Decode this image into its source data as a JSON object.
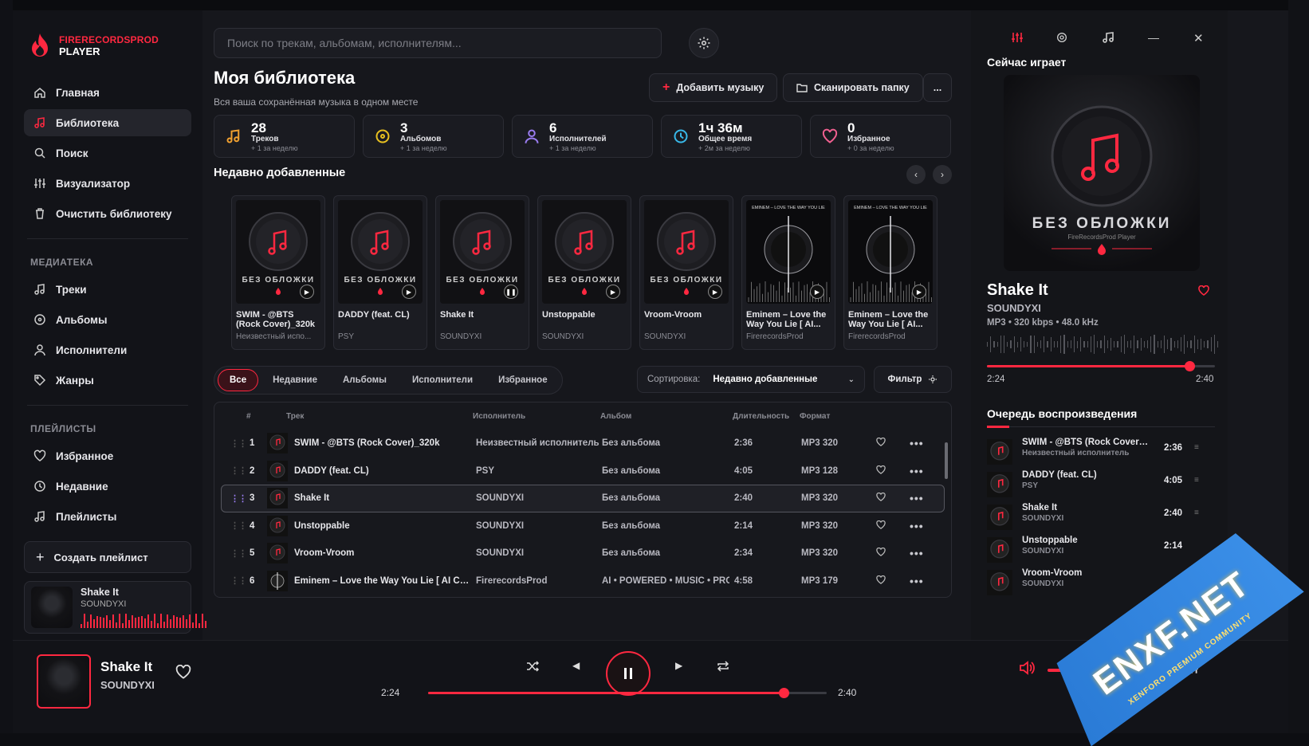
{
  "brand": {
    "name_line1": "FIRERECORDSPROD",
    "name_line2": "PLAYER"
  },
  "sidebar": {
    "nav": [
      {
        "label": "Главная",
        "icon": "home-icon"
      },
      {
        "label": "Библиотека",
        "icon": "music-note-icon",
        "active": true
      },
      {
        "label": "Поиск",
        "icon": "search-icon"
      },
      {
        "label": "Визуализатор",
        "icon": "sliders-icon"
      },
      {
        "label": "Очистить библиотеку",
        "icon": "trash-icon"
      }
    ],
    "media_title": "МЕДИАТЕКА",
    "media": [
      {
        "label": "Треки",
        "icon": "music-note-icon"
      },
      {
        "label": "Альбомы",
        "icon": "disc-icon"
      },
      {
        "label": "Исполнители",
        "icon": "user-icon"
      },
      {
        "label": "Жанры",
        "icon": "tag-icon"
      }
    ],
    "playlists_title": "ПЛЕЙЛИСТЫ",
    "playlists": [
      {
        "label": "Избранное",
        "icon": "heart-icon"
      },
      {
        "label": "Недавние",
        "icon": "clock-icon"
      },
      {
        "label": "Плейлисты",
        "icon": "music-note-icon"
      }
    ],
    "create_playlist": "Создать плейлист",
    "mini_now": {
      "title": "Shake It",
      "artist": "SOUNDYXI"
    }
  },
  "main": {
    "search_placeholder": "Поиск по трекам, альбомам, исполнителям...",
    "title": "Моя библиотека",
    "subtitle": "Вся ваша сохранённая музыка в одном месте",
    "add_music": "Добавить музыку",
    "scan_folder": "Сканировать папку",
    "more": "...",
    "stats": [
      {
        "value": "28",
        "label": "Треков",
        "delta": "+ 1 за неделю",
        "icon": "music-note-icon",
        "color": "#f0a030"
      },
      {
        "value": "3",
        "label": "Альбомов",
        "delta": "+ 1 за неделю",
        "icon": "disc-icon",
        "color": "#e8c020"
      },
      {
        "value": "6",
        "label": "Исполнителей",
        "delta": "+ 1 за неделю",
        "icon": "user-icon",
        "color": "#9a7cf0"
      },
      {
        "value": "1ч 36м",
        "label": "Общее время",
        "delta": "+ 2м за неделю",
        "icon": "clock-icon",
        "color": "#38b8e8"
      },
      {
        "value": "0",
        "label": "Избранное",
        "delta": "+ 0 за неделю",
        "icon": "heart-icon",
        "color": "#f06090"
      }
    ],
    "recent_title": "Недавно добавленные",
    "recent": [
      {
        "title": "SWIM - @BTS (Rock Cover)_320k",
        "artist": "Неизвестный испо...",
        "cover": "default"
      },
      {
        "title": "DADDY (feat. CL)",
        "artist": "PSY",
        "cover": "default"
      },
      {
        "title": "Shake It",
        "artist": "SOUNDYXI",
        "cover": "default",
        "playing": true
      },
      {
        "title": "Unstoppable",
        "artist": "SOUNDYXI",
        "cover": "default"
      },
      {
        "title": "Vroom-Vroom",
        "artist": "SOUNDYXI",
        "cover": "default"
      },
      {
        "title": "Eminem – Love the Way You Lie [ AI...",
        "artist": "FirerecordsProd",
        "cover": "eminem"
      },
      {
        "title": "Eminem – Love the Way You Lie [ AI...",
        "artist": "FirerecordsProd",
        "cover": "eminem"
      }
    ],
    "cover_text": "БЕЗ ОБЛОЖКИ",
    "eminem_cover_text": "EMINEM – LOVE THE WAY YOU LIE",
    "tabs": [
      "Все",
      "Недавние",
      "Альбомы",
      "Исполнители",
      "Избранное"
    ],
    "sort_label": "Сортировка:",
    "sort_value": "Недавно добавленные",
    "filter": "Фильтр",
    "columns": [
      "#",
      "Трек",
      "Исполнитель",
      "Альбом",
      "Длительность",
      "Формат"
    ],
    "tracks": [
      {
        "n": "1",
        "title": "SWIM - @BTS (Rock Cover)_320k",
        "artist": "Неизвестный исполнитель",
        "album": "Без альбома",
        "dur": "2:36",
        "fmt": "MP3 320"
      },
      {
        "n": "2",
        "title": "DADDY (feat. CL)",
        "artist": "PSY",
        "album": "Без альбома",
        "dur": "4:05",
        "fmt": "MP3 128"
      },
      {
        "n": "3",
        "title": "Shake It",
        "artist": "SOUNDYXI",
        "album": "Без альбома",
        "dur": "2:40",
        "fmt": "MP3 320",
        "active": true
      },
      {
        "n": "4",
        "title": "Unstoppable",
        "artist": "SOUNDYXI",
        "album": "Без альбома",
        "dur": "2:14",
        "fmt": "MP3 320"
      },
      {
        "n": "5",
        "title": "Vroom-Vroom",
        "artist": "SOUNDYXI",
        "album": "Без альбома",
        "dur": "2:34",
        "fmt": "MP3 320"
      },
      {
        "n": "6",
        "title": "Eminem – Love the Way You Lie [ AI Cove...",
        "artist": "FirerecordsProd",
        "album": "AI • POWERED • MUSIC • PROD",
        "dur": "4:58",
        "fmt": "MP3 179"
      }
    ]
  },
  "right": {
    "now_playing_label": "Сейчас играет",
    "title": "Shake It",
    "artist": "SOUNDYXI",
    "meta": "MP3 • 320 kbps • 48.0 kHz",
    "elapsed": "2:24",
    "total": "2:40",
    "progress": 0.9,
    "cover_text": "БЕЗ ОБЛОЖКИ",
    "cover_sub": "FireRecordsProd Player",
    "queue_title": "Очередь воспроизведения",
    "queue": [
      {
        "title": "SWIM - @BTS (Rock Cover)_...",
        "artist": "Неизвестный исполнитель",
        "dur": "2:36"
      },
      {
        "title": "DADDY (feat. CL)",
        "artist": "PSY",
        "dur": "4:05"
      },
      {
        "title": "Shake It",
        "artist": "SOUNDYXI",
        "dur": "2:40"
      },
      {
        "title": "Unstoppable",
        "artist": "SOUNDYXI",
        "dur": "2:14"
      },
      {
        "title": "Vroom-Vroom",
        "artist": "SOUNDYXI",
        "dur": ""
      }
    ]
  },
  "player": {
    "title": "Shake It",
    "artist": "SOUNDYXI",
    "elapsed": "2:24",
    "total": "2:40",
    "progress": 0.89,
    "volume": 0.5
  },
  "watermark": {
    "text": "ENXF.NET",
    "sub": "XENFORO PREMIUM COMMUNITY"
  },
  "colors": {
    "accent": "#ff2840",
    "bg": "#16171c"
  }
}
